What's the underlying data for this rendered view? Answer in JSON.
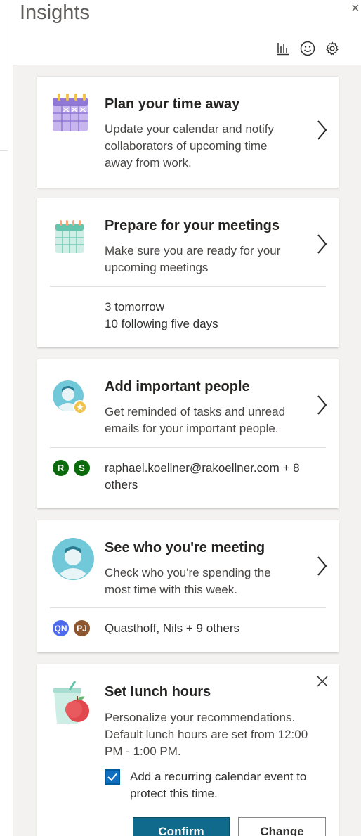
{
  "header": {
    "title": "Insights",
    "close_glyph": "×",
    "toolbar_icons": [
      "chart-icon",
      "smiley-icon",
      "gear-icon"
    ]
  },
  "cards": {
    "time_away": {
      "title": "Plan your time away",
      "description": "Update your calendar and notify collaborators of upcoming time away from work.",
      "icon": "calendar-away-icon"
    },
    "meetings": {
      "title": "Prepare for your meetings",
      "description": "Make sure you are ready for your upcoming meetings",
      "stat_tomorrow": "3 tomorrow",
      "stat_following": "10 following five days",
      "icon": "calendar-icon"
    },
    "important_people": {
      "title": "Add important people",
      "description": "Get reminded of tasks and unread emails for your important people.",
      "people": "raphael.koellner@rakoellner.com + 8 others",
      "avatars": [
        {
          "initials": "R",
          "color": "#0b6a0b"
        },
        {
          "initials": "S",
          "color": "#0b6a0b"
        }
      ],
      "icon": "person-star-icon"
    },
    "who_meeting": {
      "title": "See who you're meeting",
      "description": "Check who you're spending the most time with this week.",
      "people": "Quasthoff, Nils + 9 others",
      "avatars": [
        {
          "initials": "QN",
          "color": "#4f6bed"
        },
        {
          "initials": "PJ",
          "color": "#8e562e"
        }
      ],
      "icon": "person-icon"
    },
    "lunch": {
      "title": "Set lunch hours",
      "description": "Personalize your recommendations. Default lunch hours are set from 12:00 PM - 1:00 PM.",
      "checkbox_label": "Add a recurring calendar event to protect this time.",
      "checkbox_checked": true,
      "confirm_label": "Confirm",
      "change_label": "Change",
      "icon": "lunch-icon"
    }
  },
  "colors": {
    "accent": "#0f6a8b",
    "checkbox": "#106ebe",
    "panel_bg": "#f3f2f1"
  }
}
